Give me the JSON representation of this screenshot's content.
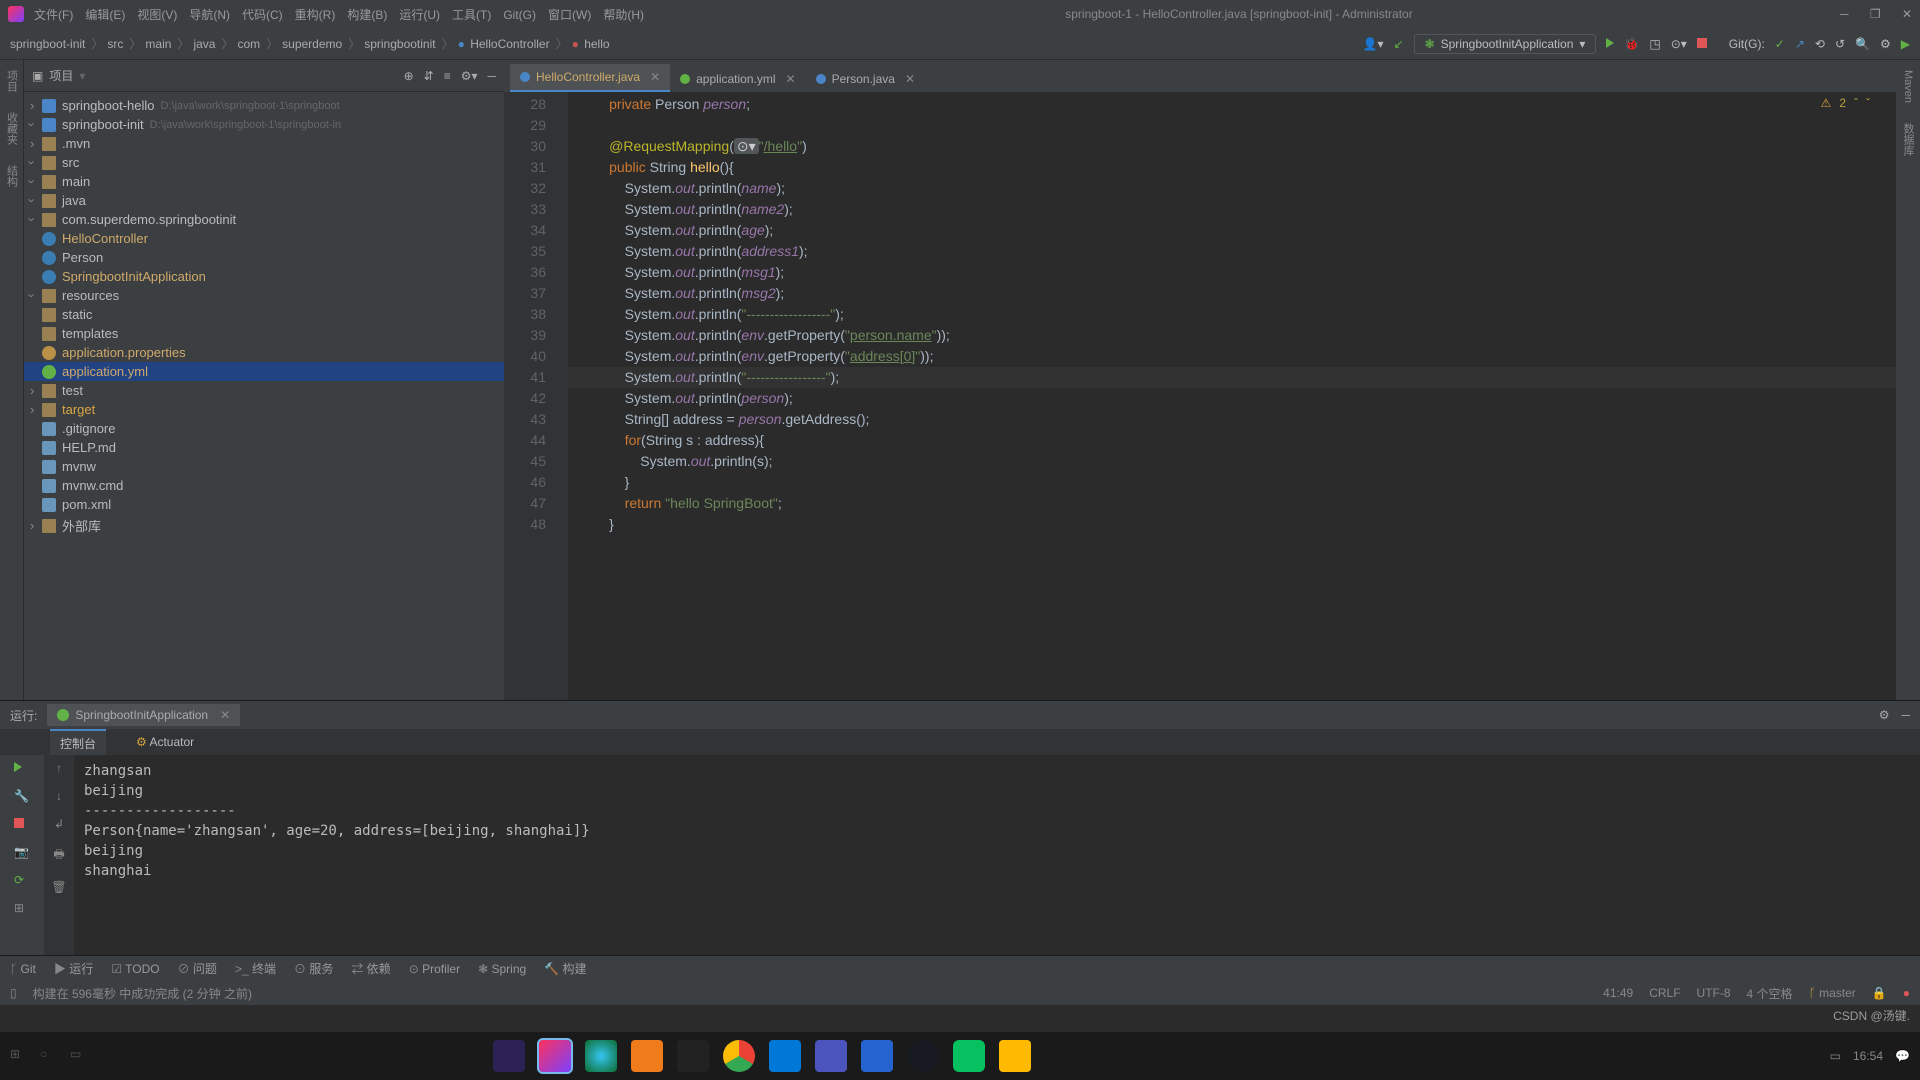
{
  "window": {
    "title": "springboot-1 - HelloController.java [springboot-init] - Administrator"
  },
  "menus": [
    "文件(F)",
    "编辑(E)",
    "视图(V)",
    "导航(N)",
    "代码(C)",
    "重构(R)",
    "构建(B)",
    "运行(U)",
    "工具(T)",
    "Git(G)",
    "窗口(W)",
    "帮助(H)"
  ],
  "breadcrumbs": [
    "springboot-init",
    "src",
    "main",
    "java",
    "com",
    "superdemo",
    "springbootinit",
    "HelloController",
    "hello"
  ],
  "runconfig": {
    "name": "SpringbootInitApplication",
    "git_label": "Git(G):"
  },
  "project_panel_title": "项目",
  "project_tree": [
    {
      "indent": 0,
      "type": "module",
      "name": "springboot-hello",
      "path": "D:\\java\\work\\springboot-1\\springboot",
      "arrow": "closed"
    },
    {
      "indent": 0,
      "type": "module",
      "name": "springboot-init",
      "path": "D:\\java\\work\\springboot-1\\springboot-in",
      "arrow": "open"
    },
    {
      "indent": 1,
      "type": "folder",
      "name": ".mvn",
      "arrow": "closed"
    },
    {
      "indent": 1,
      "type": "folder",
      "name": "src",
      "arrow": "open"
    },
    {
      "indent": 2,
      "type": "folder",
      "name": "main",
      "arrow": "open"
    },
    {
      "indent": 3,
      "type": "folder",
      "name": "java",
      "arrow": "open"
    },
    {
      "indent": 4,
      "type": "folder",
      "name": "com.superdemo.springbootinit",
      "arrow": "open"
    },
    {
      "indent": 5,
      "type": "java",
      "name": "HelloController",
      "cls": "linkc"
    },
    {
      "indent": 5,
      "type": "java",
      "name": "Person"
    },
    {
      "indent": 5,
      "type": "java",
      "name": "SpringbootInitApplication",
      "cls": "linkc"
    },
    {
      "indent": 3,
      "type": "folder",
      "name": "resources",
      "arrow": "open"
    },
    {
      "indent": 4,
      "type": "folder",
      "name": "static"
    },
    {
      "indent": 4,
      "type": "folder",
      "name": "templates"
    },
    {
      "indent": 4,
      "type": "prop",
      "name": "application.properties",
      "cls": "linkc"
    },
    {
      "indent": 4,
      "type": "yml",
      "name": "application.yml",
      "sel": true,
      "cls": "linkc"
    },
    {
      "indent": 2,
      "type": "folder",
      "name": "test",
      "arrow": "closed"
    },
    {
      "indent": 1,
      "type": "folder",
      "name": "target",
      "arrow": "closed",
      "cls": "target"
    },
    {
      "indent": 1,
      "type": "file",
      "name": ".gitignore"
    },
    {
      "indent": 1,
      "type": "file",
      "name": "HELP.md"
    },
    {
      "indent": 1,
      "type": "file",
      "name": "mvnw"
    },
    {
      "indent": 1,
      "type": "file",
      "name": "mvnw.cmd"
    },
    {
      "indent": 1,
      "type": "file",
      "name": "pom.xml"
    },
    {
      "indent": 0,
      "type": "lib",
      "name": "外部库",
      "arrow": "closed"
    }
  ],
  "editor_tabs": [
    {
      "name": "HelloController.java",
      "active": true,
      "kind": "java"
    },
    {
      "name": "application.yml",
      "active": false,
      "kind": "yml"
    },
    {
      "name": "Person.java",
      "active": false,
      "kind": "java"
    }
  ],
  "inspection_badge": "2",
  "gutter_start": 28,
  "code_lines": [
    {
      "n": 28,
      "html": "        <span class='kw'>private</span> Person <span class='field'>person</span>;"
    },
    {
      "n": 29,
      "html": ""
    },
    {
      "n": 30,
      "html": "        <span class='ann'>@RequestMapping</span>(<span style='background:#515658;border-radius:3px;padding:0 3px;color:#ccc'>⊙▾</span><span class='str'>\"</span><span class='url'>/hello</span><span class='str'>\"</span>)"
    },
    {
      "n": 31,
      "html": "        <span class='kw'>public</span> String <span style='color:#ffc66d'>hello</span>(){"
    },
    {
      "n": 32,
      "html": "            System.<span class='field'>out</span>.println(<span class='field'>name</span>);"
    },
    {
      "n": 33,
      "html": "            System.<span class='field'>out</span>.println(<span class='field'>name2</span>);"
    },
    {
      "n": 34,
      "html": "            System.<span class='field'>out</span>.println(<span class='field'>age</span>);"
    },
    {
      "n": 35,
      "html": "            System.<span class='field'>out</span>.println(<span class='field'>address1</span>);"
    },
    {
      "n": 36,
      "html": "            System.<span class='field'>out</span>.println(<span class='field'>msg1</span>);"
    },
    {
      "n": 37,
      "html": "            System.<span class='field'>out</span>.println(<span class='field'>msg2</span>);"
    },
    {
      "n": 38,
      "html": "            System.<span class='field'>out</span>.println(<span class='str'>\"------------------\"</span>);"
    },
    {
      "n": 39,
      "html": "            System.<span class='field'>out</span>.println(<span class='field'>env</span>.getProperty(<span class='str'>\"</span><span class='url'>person.name</span><span class='str'>\"</span>));"
    },
    {
      "n": 40,
      "html": "            System.<span class='field'>out</span>.println(<span class='field'>env</span>.getProperty(<span class='str'>\"</span><span class='url'>address[0]</span><span class='str'>\"</span>));"
    },
    {
      "n": 41,
      "html": "            System.<span class='field'>out</span>.println(<span class='str'>\"-----------------\"</span>);",
      "hl": true
    },
    {
      "n": 42,
      "html": "            System.<span class='field'>out</span>.println(<span class='field'>person</span>);"
    },
    {
      "n": 43,
      "html": "            String[] address = <span class='field'>person</span>.getAddress();"
    },
    {
      "n": 44,
      "html": "            <span class='kw'>for</span>(String s : address){"
    },
    {
      "n": 45,
      "html": "                System.<span class='field'>out</span>.println(s);"
    },
    {
      "n": 46,
      "html": "            }"
    },
    {
      "n": 47,
      "html": "            <span class='kw'>return</span> <span class='str'>\"hello SpringBoot\"</span>;"
    },
    {
      "n": 48,
      "html": "        }"
    }
  ],
  "run": {
    "label": "运行:",
    "tab": "SpringbootInitApplication",
    "subtabs": [
      "控制台",
      "Actuator"
    ],
    "active_subtab": 0,
    "console": "zhangsan\nbeijing\n------------------\nPerson{name='zhangsan', age=20, address=[beijing, shanghai]}\nbeijing\nshanghai"
  },
  "bottom": [
    "Git",
    "运行",
    "TODO",
    "问题",
    "终端",
    "服务",
    "依赖",
    "Profiler",
    "Spring",
    "构建"
  ],
  "status": {
    "build": "构建在 596毫秒 中成功完成 (2 分钟 之前)",
    "pos": "41:49",
    "eol": "CRLF",
    "enc": "UTF-8",
    "indent": "4 个空格",
    "branch": "master"
  },
  "left_tools": [
    "项目",
    "收藏夹",
    "结构"
  ],
  "right_tools": [
    "Maven",
    "数据库"
  ],
  "watermark": "CSDN @汤键.",
  "taskbar_time": "16:54"
}
